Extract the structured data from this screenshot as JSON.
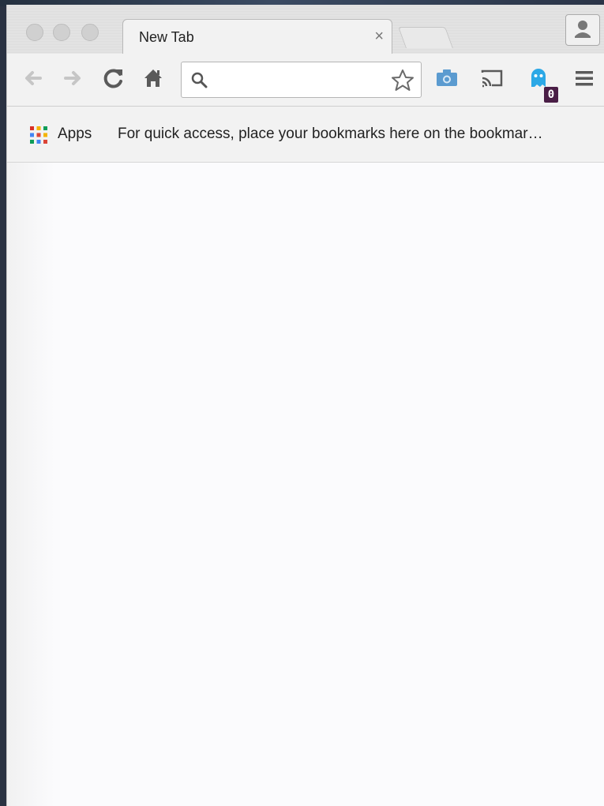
{
  "window": {
    "tab": {
      "title": "New Tab",
      "close_icon": "×"
    }
  },
  "toolbar": {
    "omnibox": {
      "value": "",
      "placeholder": ""
    },
    "extension_badge": "0"
  },
  "bookmarks_bar": {
    "apps_label": "Apps",
    "hint": "For quick access, place your bookmarks here on the bookmar…"
  },
  "colors": {
    "apps_grid": [
      "#d93025",
      "#f4b400",
      "#0f9d58",
      "#4285f4",
      "#db4437",
      "#f4b400",
      "#0f9d58",
      "#4285f4",
      "#db4437"
    ],
    "extension_ghost": "#2ca8e6",
    "camera_icon": "#4a90c8",
    "badge_bg": "#4a1e46"
  }
}
